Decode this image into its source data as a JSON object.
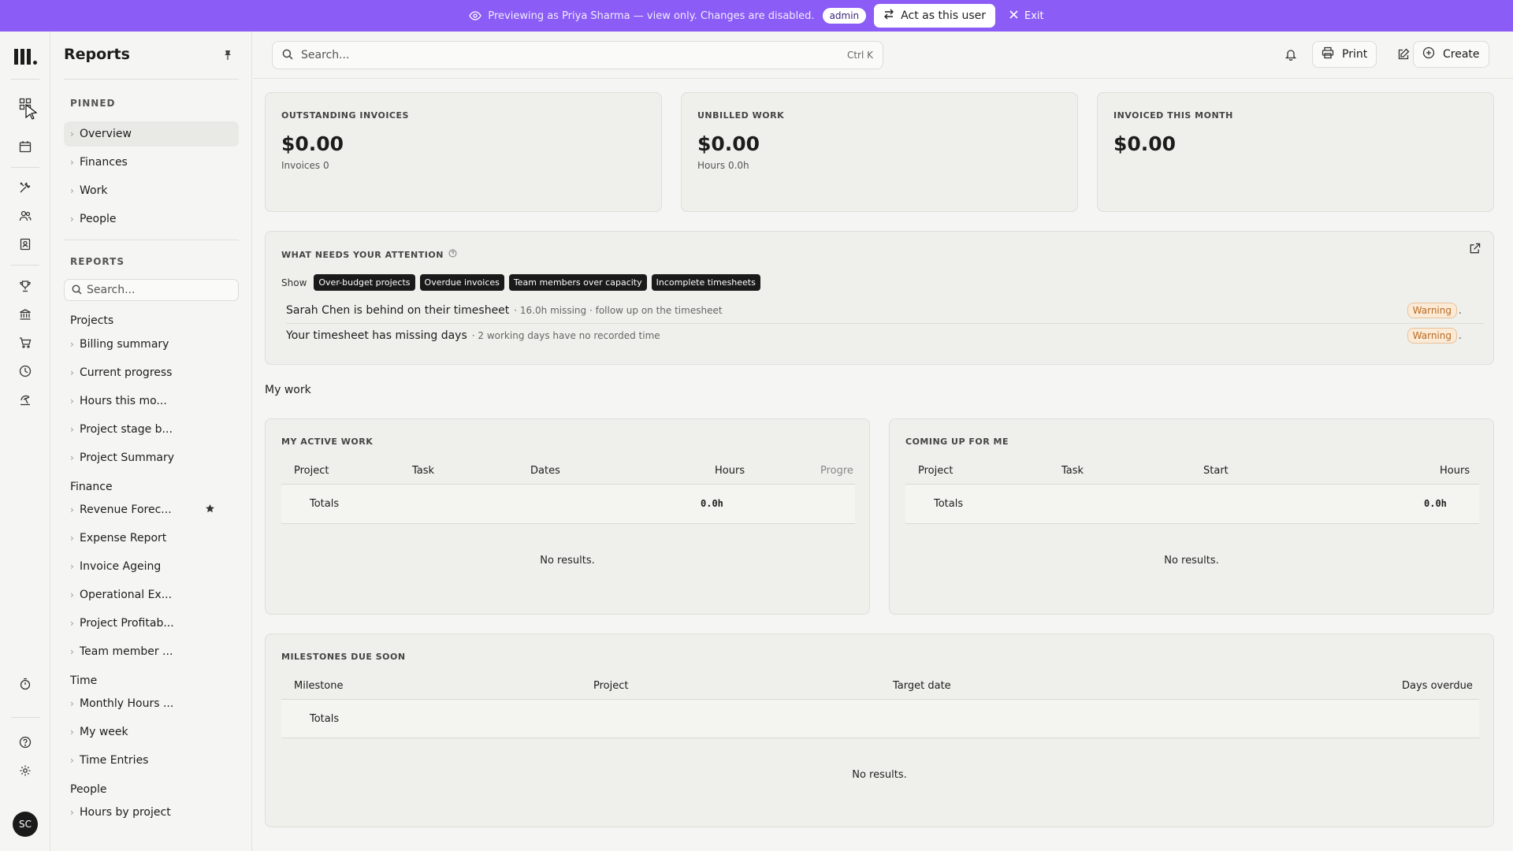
{
  "banner": {
    "message": "Previewing as Priya Sharma — view only. Changes are disabled.",
    "role": "admin",
    "act_label": "Act as this user",
    "exit_label": "Exit"
  },
  "rail": {
    "avatar": "SC"
  },
  "sidebar": {
    "title": "Reports",
    "pinned_heading": "PINNED",
    "pinned": [
      "Overview",
      "Finances",
      "Work",
      "People"
    ],
    "reports_heading": "REPORTS",
    "search_placeholder": "Search...",
    "groups": [
      {
        "name": "Projects",
        "items": [
          "Billing summary",
          "Current progress",
          "Hours this mo...",
          "Project stage b...",
          "Project Summary"
        ]
      },
      {
        "name": "Finance",
        "items": [
          "Revenue Forec...",
          "Expense Report",
          "Invoice Ageing",
          "Operational Ex...",
          "Project Profitab...",
          "Team member ..."
        ]
      },
      {
        "name": "Time",
        "items": [
          "Monthly Hours ...",
          "My week",
          "Time Entries"
        ]
      },
      {
        "name": "People",
        "items": [
          "Hours by project"
        ]
      }
    ]
  },
  "topbar": {
    "search_placeholder": "Search...",
    "shortcut": "Ctrl K",
    "print_label": "Print",
    "create_label": "Create"
  },
  "stats": [
    {
      "label": "OUTSTANDING INVOICES",
      "value": "$0.00",
      "sub": "Invoices 0"
    },
    {
      "label": "UNBILLED WORK",
      "value": "$0.00",
      "sub": "Hours 0.0h"
    },
    {
      "label": "INVOICED THIS MONTH",
      "value": "$0.00",
      "sub": ""
    }
  ],
  "attention": {
    "title": "WHAT NEEDS YOUR ATTENTION",
    "show_label": "Show",
    "filters": [
      "Over-budget projects",
      "Overdue invoices",
      "Team members over capacity",
      "Incomplete timesheets"
    ],
    "items": [
      {
        "text": "Sarah Chen is behind on their timesheet",
        "note": "· 16.0h missing · follow up on the timesheet",
        "badge": "Warning"
      },
      {
        "text": "Your timesheet has missing days",
        "note": "· 2 working days have no recorded time",
        "badge": "Warning"
      }
    ]
  },
  "my_work": {
    "heading": "My work",
    "active": {
      "title": "MY ACTIVE WORK",
      "columns": [
        "Project",
        "Task",
        "Dates",
        "Hours",
        "Progre"
      ],
      "totals_label": "Totals",
      "totals_hours": "0.0h",
      "empty": "No results."
    },
    "upcoming": {
      "title": "COMING UP FOR ME",
      "columns": [
        "Project",
        "Task",
        "Start",
        "Hours"
      ],
      "totals_label": "Totals",
      "totals_hours": "0.0h",
      "empty": "No results."
    }
  },
  "milestones": {
    "title": "MILESTONES DUE SOON",
    "columns": [
      "Milestone",
      "Project",
      "Target date",
      "Days overdue"
    ],
    "totals_label": "Totals",
    "empty": "No results."
  }
}
